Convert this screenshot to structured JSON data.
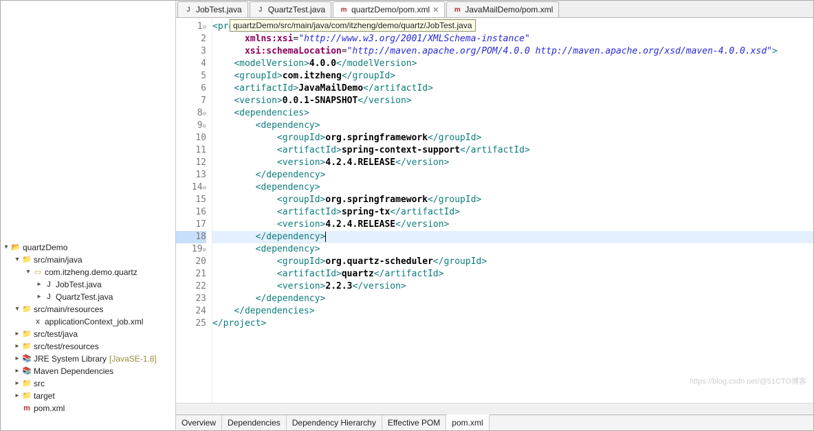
{
  "explorer": {
    "project": "quartzDemo",
    "nodes": [
      {
        "indent": 0,
        "twist": "▾",
        "icon": "proj",
        "label": "quartzDemo"
      },
      {
        "indent": 1,
        "twist": "▾",
        "icon": "srcfolder",
        "label": "src/main/java"
      },
      {
        "indent": 2,
        "twist": "▾",
        "icon": "package",
        "label": "com.itzheng.demo.quartz"
      },
      {
        "indent": 3,
        "twist": "▸",
        "icon": "java",
        "label": "JobTest.java"
      },
      {
        "indent": 3,
        "twist": "▸",
        "icon": "java",
        "label": "QuartzTest.java"
      },
      {
        "indent": 1,
        "twist": "▾",
        "icon": "srcfolder",
        "label": "src/main/resources"
      },
      {
        "indent": 2,
        "twist": "",
        "icon": "xml",
        "label": "applicationContext_job.xml"
      },
      {
        "indent": 1,
        "twist": "▸",
        "icon": "srcfolder",
        "label": "src/test/java"
      },
      {
        "indent": 1,
        "twist": "▸",
        "icon": "srcfolder",
        "label": "src/test/resources"
      },
      {
        "indent": 1,
        "twist": "▸",
        "icon": "lib",
        "label": "JRE System Library",
        "decor": "[JavaSE-1.8]"
      },
      {
        "indent": 1,
        "twist": "▸",
        "icon": "lib",
        "label": "Maven Dependencies"
      },
      {
        "indent": 1,
        "twist": "▸",
        "icon": "folder",
        "label": "src"
      },
      {
        "indent": 1,
        "twist": "▸",
        "icon": "folder",
        "label": "target"
      },
      {
        "indent": 1,
        "twist": "",
        "icon": "mvn",
        "label": "pom.xml"
      }
    ]
  },
  "tabs": [
    {
      "icon": "java",
      "label": "JobTest.java",
      "active": false
    },
    {
      "icon": "java",
      "label": "QuartzTest.java",
      "active": false
    },
    {
      "icon": "mvn",
      "label": "quartzDemo/pom.xml",
      "active": true
    },
    {
      "icon": "mvn",
      "label": "JavaMailDemo/pom.xml",
      "active": false
    }
  ],
  "tooltip": "quartzDemo/src/main/java/com/itzheng/demo/quartz/JobTest.java",
  "code_lines": [
    {
      "n": "1",
      "fold": "⊖",
      "html": "<span class='punct'>&lt;</span><span class='tag'>proj</span>"
    },
    {
      "n": "2",
      "fold": "",
      "html": "      <span class='attr'>xmlns:xsi</span>=<span class='str'>\"http://www.w3.org/2001/XMLSchema-instance\"</span>"
    },
    {
      "n": "3",
      "fold": "",
      "html": "      <span class='attr'>xsi:schemaLocation</span>=<span class='str'>\"http://maven.apache.org/POM/4.0.0 http://maven.apache.org/xsd/maven-4.0.0.xsd\"</span><span class='punct'>&gt;</span>"
    },
    {
      "n": "4",
      "fold": "",
      "html": "    <span class='punct'>&lt;</span><span class='tag'>modelVersion</span><span class='punct'>&gt;</span><span class='text'>4.0.0</span><span class='punct'>&lt;/</span><span class='tag'>modelVersion</span><span class='punct'>&gt;</span>"
    },
    {
      "n": "5",
      "fold": "",
      "html": "    <span class='punct'>&lt;</span><span class='tag'>groupId</span><span class='punct'>&gt;</span><span class='text'>com.itzheng</span><span class='punct'>&lt;/</span><span class='tag'>groupId</span><span class='punct'>&gt;</span>"
    },
    {
      "n": "6",
      "fold": "",
      "html": "    <span class='punct'>&lt;</span><span class='tag'>artifactId</span><span class='punct'>&gt;</span><span class='text'>JavaMailDemo</span><span class='punct'>&lt;/</span><span class='tag'>artifactId</span><span class='punct'>&gt;</span>"
    },
    {
      "n": "7",
      "fold": "",
      "html": "    <span class='punct'>&lt;</span><span class='tag'>version</span><span class='punct'>&gt;</span><span class='text'>0.0.1-SNAPSHOT</span><span class='punct'>&lt;/</span><span class='tag'>version</span><span class='punct'>&gt;</span>"
    },
    {
      "n": "8",
      "fold": "⊖",
      "html": "    <span class='punct'>&lt;</span><span class='tag'>dependencies</span><span class='punct'>&gt;</span>"
    },
    {
      "n": "9",
      "fold": "⊖",
      "html": "        <span class='punct'>&lt;</span><span class='tag'>dependency</span><span class='punct'>&gt;</span>"
    },
    {
      "n": "10",
      "fold": "",
      "html": "            <span class='punct'>&lt;</span><span class='tag'>groupId</span><span class='punct'>&gt;</span><span class='text'>org.springframework</span><span class='punct'>&lt;/</span><span class='tag'>groupId</span><span class='punct'>&gt;</span>"
    },
    {
      "n": "11",
      "fold": "",
      "html": "            <span class='punct'>&lt;</span><span class='tag'>artifactId</span><span class='punct'>&gt;</span><span class='text'>spring-context-support</span><span class='punct'>&lt;/</span><span class='tag'>artifactId</span><span class='punct'>&gt;</span>"
    },
    {
      "n": "12",
      "fold": "",
      "html": "            <span class='punct'>&lt;</span><span class='tag'>version</span><span class='punct'>&gt;</span><span class='text'>4.2.4.RELEASE</span><span class='punct'>&lt;/</span><span class='tag'>version</span><span class='punct'>&gt;</span>"
    },
    {
      "n": "13",
      "fold": "",
      "html": "        <span class='punct'>&lt;/</span><span class='tag'>dependency</span><span class='punct'>&gt;</span>"
    },
    {
      "n": "14",
      "fold": "⊖",
      "html": "        <span class='punct'>&lt;</span><span class='tag'>dependency</span><span class='punct'>&gt;</span>"
    },
    {
      "n": "15",
      "fold": "",
      "html": "            <span class='punct'>&lt;</span><span class='tag'>groupId</span><span class='punct'>&gt;</span><span class='text'>org.springframework</span><span class='punct'>&lt;/</span><span class='tag'>groupId</span><span class='punct'>&gt;</span>"
    },
    {
      "n": "16",
      "fold": "",
      "html": "            <span class='punct'>&lt;</span><span class='tag'>artifactId</span><span class='punct'>&gt;</span><span class='text'>spring-tx</span><span class='punct'>&lt;/</span><span class='tag'>artifactId</span><span class='punct'>&gt;</span>"
    },
    {
      "n": "17",
      "fold": "",
      "html": "            <span class='punct'>&lt;</span><span class='tag'>version</span><span class='punct'>&gt;</span><span class='text'>4.2.4.RELEASE</span><span class='punct'>&lt;/</span><span class='tag'>version</span><span class='punct'>&gt;</span>"
    },
    {
      "n": "18",
      "fold": "",
      "hl": true,
      "html": "        <span class='punct'>&lt;/</span><span class='tag'>dependency</span><span class='punct cursor'>&gt;</span>"
    },
    {
      "n": "19",
      "fold": "⊖",
      "html": "        <span class='punct'>&lt;</span><span class='tag'>dependency</span><span class='punct'>&gt;</span>"
    },
    {
      "n": "20",
      "fold": "",
      "html": "            <span class='punct'>&lt;</span><span class='tag'>groupId</span><span class='punct'>&gt;</span><span class='text'>org.quartz-scheduler</span><span class='punct'>&lt;/</span><span class='tag'>groupId</span><span class='punct'>&gt;</span>"
    },
    {
      "n": "21",
      "fold": "",
      "html": "            <span class='punct'>&lt;</span><span class='tag'>artifactId</span><span class='punct'>&gt;</span><span class='text'>quartz</span><span class='punct'>&lt;/</span><span class='tag'>artifactId</span><span class='punct'>&gt;</span>"
    },
    {
      "n": "22",
      "fold": "",
      "html": "            <span class='punct'>&lt;</span><span class='tag'>version</span><span class='punct'>&gt;</span><span class='text'>2.2.3</span><span class='punct'>&lt;/</span><span class='tag'>version</span><span class='punct'>&gt;</span>"
    },
    {
      "n": "23",
      "fold": "",
      "html": "        <span class='punct'>&lt;/</span><span class='tag'>dependency</span><span class='punct'>&gt;</span>"
    },
    {
      "n": "24",
      "fold": "",
      "html": "    <span class='punct'>&lt;/</span><span class='tag'>dependencies</span><span class='punct'>&gt;</span>"
    },
    {
      "n": "25",
      "fold": "",
      "html": "<span class='punct'>&lt;/</span><span class='tag'>project</span><span class='punct'>&gt;</span>"
    }
  ],
  "pom_tabs": [
    "Overview",
    "Dependencies",
    "Dependency Hierarchy",
    "Effective POM",
    "pom.xml"
  ],
  "pom_active": "pom.xml",
  "watermark": "https://blog.csdn.net/@51CTO博客"
}
